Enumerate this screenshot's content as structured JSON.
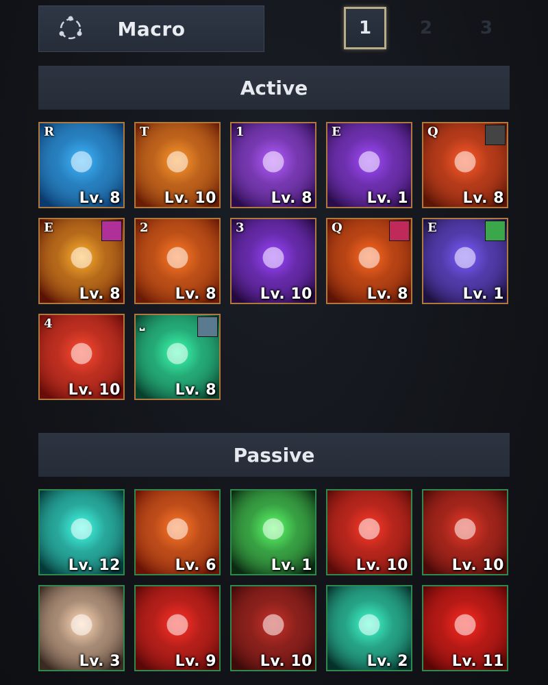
{
  "macro": {
    "label": "Macro",
    "icon": "macro-cycle-icon"
  },
  "pages": [
    {
      "label": "1",
      "active": true
    },
    {
      "label": "2",
      "active": false
    },
    {
      "label": "3",
      "active": false
    }
  ],
  "active": {
    "title": "Active",
    "skills": [
      {
        "key": "R",
        "level": "Lv. 8",
        "icon": "blue-target-sight-icon",
        "colors": [
          "#0b3a6e",
          "#3fb8ff"
        ],
        "badge": ""
      },
      {
        "key": "T",
        "level": "Lv. 10",
        "icon": "arrow-barrage-icon",
        "colors": [
          "#6a1d05",
          "#ff9a2e"
        ],
        "badge": ""
      },
      {
        "key": "1",
        "level": "Lv. 8",
        "icon": "purple-vortex-icon",
        "colors": [
          "#2a0c4e",
          "#b45cff"
        ],
        "badge": ""
      },
      {
        "key": "E",
        "level": "Lv. 1",
        "icon": "rune-glyph-icon",
        "colors": [
          "#2b0d4a",
          "#a34cff"
        ],
        "badge": ""
      },
      {
        "key": "Q",
        "level": "Lv. 8",
        "icon": "archer-piercing-shot-icon",
        "colors": [
          "#5a1506",
          "#ff5a2a"
        ],
        "badge": "#444444"
      },
      {
        "key": "E",
        "level": "Lv. 8",
        "icon": "fire-sun-burst-icon",
        "colors": [
          "#5a1203",
          "#ffb12e"
        ],
        "badge": "#b0309a"
      },
      {
        "key": "2",
        "level": "Lv. 8",
        "icon": "fire-bolt-shot-icon",
        "colors": [
          "#6a1a05",
          "#ff7a26"
        ],
        "badge": ""
      },
      {
        "key": "3",
        "level": "Lv. 10",
        "icon": "purple-whirlwind-icon",
        "colors": [
          "#24093e",
          "#9b45ff"
        ],
        "badge": ""
      },
      {
        "key": "Q",
        "level": "Lv. 8",
        "icon": "flaming-arrow-icon",
        "colors": [
          "#5e1404",
          "#ff6a22"
        ],
        "badge": "#c02a5a"
      },
      {
        "key": "E",
        "level": "Lv. 1",
        "icon": "dark-knight-aura-icon",
        "colors": [
          "#1e1240",
          "#7a5cff"
        ],
        "badge": "#3aa84a"
      },
      {
        "key": "4",
        "level": "Lv. 10",
        "icon": "crimson-star-burst-icon",
        "colors": [
          "#6a0d0a",
          "#ff4a32"
        ],
        "badge": ""
      },
      {
        "key": "⎵",
        "level": "Lv. 8",
        "icon": "green-wind-dash-icon",
        "colors": [
          "#08402e",
          "#3cffb0"
        ],
        "badge": "#5a7a90"
      }
    ]
  },
  "passive": {
    "title": "Passive",
    "skills": [
      {
        "level": "Lv. 12",
        "icon": "teal-eye-icon",
        "colors": [
          "#053a3a",
          "#44ffe8"
        ]
      },
      {
        "level": "Lv. 6",
        "icon": "meteor-rain-icon",
        "colors": [
          "#6a1205",
          "#ff7a2a"
        ]
      },
      {
        "level": "Lv. 1",
        "icon": "green-shadow-step-icon",
        "colors": [
          "#0b2a12",
          "#5cff6a"
        ]
      },
      {
        "level": "Lv. 10",
        "icon": "red-eye-icon",
        "colors": [
          "#5a0c0a",
          "#ff3a2a"
        ]
      },
      {
        "level": "Lv. 10",
        "icon": "blood-moon-hand-icon",
        "colors": [
          "#4a0a08",
          "#e83a2a"
        ]
      },
      {
        "level": "Lv. 3",
        "icon": "moon-huntress-icon",
        "colors": [
          "#3a2a22",
          "#ffd9b8"
        ]
      },
      {
        "level": "Lv. 9",
        "icon": "red-eye-arrow-icon",
        "colors": [
          "#5a0808",
          "#ff3228"
        ]
      },
      {
        "level": "Lv. 10",
        "icon": "crimson-warrior-icon",
        "colors": [
          "#3e0a0a",
          "#c8322a"
        ]
      },
      {
        "level": "Lv. 2",
        "icon": "aurora-fallen-icon",
        "colors": [
          "#06302a",
          "#40ffd0"
        ]
      },
      {
        "level": "Lv. 11",
        "icon": "howling-wolf-moon-icon",
        "colors": [
          "#5a0606",
          "#ff2a22"
        ]
      }
    ]
  }
}
